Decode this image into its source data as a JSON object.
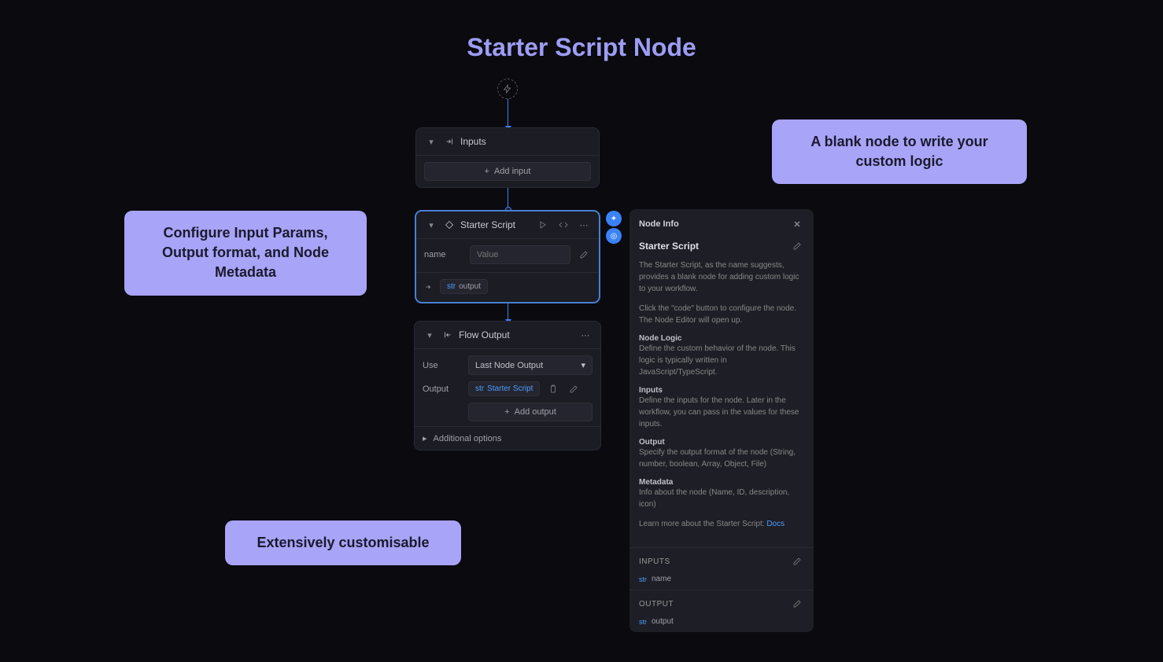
{
  "title": "Starter Script Node",
  "callouts": {
    "left": "Configure Input Params, Output format, and Node Metadata",
    "right": "A blank node to write your custom logic",
    "bottom": "Extensively customisable"
  },
  "inputs_node": {
    "label": "Inputs",
    "add_button": "Add input"
  },
  "script_node": {
    "label": "Starter Script",
    "param_name": "name",
    "param_placeholder": "Value",
    "output_chip": "output"
  },
  "flow_output_node": {
    "label": "Flow Output",
    "use_label": "Use",
    "use_value": "Last Node Output",
    "output_label": "Output",
    "output_chip": "Starter Script",
    "add_output": "Add output",
    "additional_options": "Additional options"
  },
  "node_info": {
    "header": "Node Info",
    "title": "Starter Script",
    "desc1": "The Starter Script, as the name suggests, provides a blank node for adding custom logic to your workflow.",
    "desc2": "Click the \"code\" button to configure the node. The Node Editor will open up.",
    "logic_title": "Node Logic",
    "logic_text": "Define the custom behavior of the node. This logic is typically written in JavaScript/TypeScript.",
    "inputs_title": "Inputs",
    "inputs_text": "Define the inputs for the node. Later in the workflow, you can pass in the values for these inputs.",
    "output_title": "Output",
    "output_text": "Specify the output format of the node (String, number, boolean, Array, Object, File)",
    "metadata_title": "Metadata",
    "metadata_text": "Info about the node (Name, ID, description, icon)",
    "learn_more": "Learn more about the Starter Script: ",
    "docs_link": "Docs",
    "inputs_section": "INPUTS",
    "input_item": "name",
    "output_section": "OUTPUT",
    "output_item": "output"
  }
}
